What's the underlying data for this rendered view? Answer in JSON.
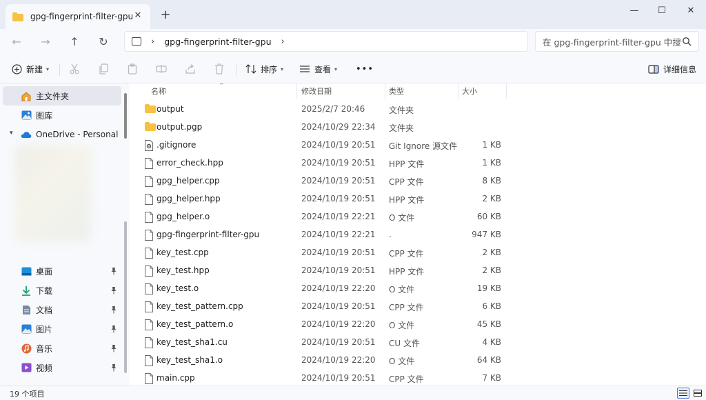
{
  "tab": {
    "title": "gpg-fingerprint-filter-gpu",
    "close": "✕",
    "new": "+"
  },
  "window": {
    "minimize": "—",
    "maximize": "☐",
    "close": "✕"
  },
  "nav": {
    "back": "←",
    "forward": "→",
    "up": "↑",
    "refresh": "↻"
  },
  "address": {
    "separator": "›",
    "crumb": "gpg-fingerprint-filter-gpu",
    "trailing": "›"
  },
  "search": {
    "placeholder": "在 gpg-fingerprint-filter-gpu 中搜"
  },
  "toolbar": {
    "new_label": "新建",
    "sort_label": "排序",
    "view_label": "查看",
    "more": "•••",
    "details_label": "详细信息"
  },
  "sidebar": {
    "home": "主文件夹",
    "gallery": "图库",
    "onedrive": "OneDrive - Personal",
    "pinned": [
      {
        "label": "桌面",
        "icon": "desktop-icon",
        "color": "#1d8fd8"
      },
      {
        "label": "下载",
        "icon": "download-icon",
        "color": "#1aa06d"
      },
      {
        "label": "文档",
        "icon": "document-icon",
        "color": "#7a8aa0"
      },
      {
        "label": "图片",
        "icon": "picture-icon",
        "color": "#2a7fd6"
      },
      {
        "label": "音乐",
        "icon": "music-icon",
        "color": "#e0663a"
      },
      {
        "label": "视频",
        "icon": "video-icon",
        "color": "#8a4fd3"
      }
    ]
  },
  "columns": {
    "name": "名称",
    "date": "修改日期",
    "type": "类型",
    "size": "大小"
  },
  "files": [
    {
      "name": "output",
      "date": "2025/2/7 20:46",
      "type": "文件夹",
      "size": "",
      "kind": "folder"
    },
    {
      "name": "output.pgp",
      "date": "2024/10/29 22:34",
      "type": "文件夹",
      "size": "",
      "kind": "folder"
    },
    {
      "name": ".gitignore",
      "date": "2024/10/19 20:51",
      "type": "Git Ignore 源文件",
      "size": "1 KB",
      "kind": "gear"
    },
    {
      "name": "error_check.hpp",
      "date": "2024/10/19 20:51",
      "type": "HPP 文件",
      "size": "1 KB",
      "kind": "file"
    },
    {
      "name": "gpg_helper.cpp",
      "date": "2024/10/19 20:51",
      "type": "CPP 文件",
      "size": "8 KB",
      "kind": "file"
    },
    {
      "name": "gpg_helper.hpp",
      "date": "2024/10/19 20:51",
      "type": "HPP 文件",
      "size": "2 KB",
      "kind": "file"
    },
    {
      "name": "gpg_helper.o",
      "date": "2024/10/19 22:21",
      "type": "O 文件",
      "size": "60 KB",
      "kind": "file"
    },
    {
      "name": "gpg-fingerprint-filter-gpu",
      "date": "2024/10/19 22:21",
      "type": ".",
      "size": "947 KB",
      "kind": "file"
    },
    {
      "name": "key_test.cpp",
      "date": "2024/10/19 20:51",
      "type": "CPP 文件",
      "size": "2 KB",
      "kind": "file"
    },
    {
      "name": "key_test.hpp",
      "date": "2024/10/19 20:51",
      "type": "HPP 文件",
      "size": "2 KB",
      "kind": "file"
    },
    {
      "name": "key_test.o",
      "date": "2024/10/19 22:20",
      "type": "O 文件",
      "size": "19 KB",
      "kind": "file"
    },
    {
      "name": "key_test_pattern.cpp",
      "date": "2024/10/19 20:51",
      "type": "CPP 文件",
      "size": "6 KB",
      "kind": "file"
    },
    {
      "name": "key_test_pattern.o",
      "date": "2024/10/19 22:20",
      "type": "O 文件",
      "size": "45 KB",
      "kind": "file"
    },
    {
      "name": "key_test_sha1.cu",
      "date": "2024/10/19 20:51",
      "type": "CU 文件",
      "size": "4 KB",
      "kind": "file"
    },
    {
      "name": "key_test_sha1.o",
      "date": "2024/10/19 22:20",
      "type": "O 文件",
      "size": "64 KB",
      "kind": "file"
    },
    {
      "name": "main.cpp",
      "date": "2024/10/19 20:51",
      "type": "CPP 文件",
      "size": "7 KB",
      "kind": "file"
    }
  ],
  "status": {
    "count": "19 个项目"
  },
  "colors": {
    "folder": "#f5c242",
    "accent": "#4a7bd8",
    "chrome": "#f7f9fc"
  }
}
